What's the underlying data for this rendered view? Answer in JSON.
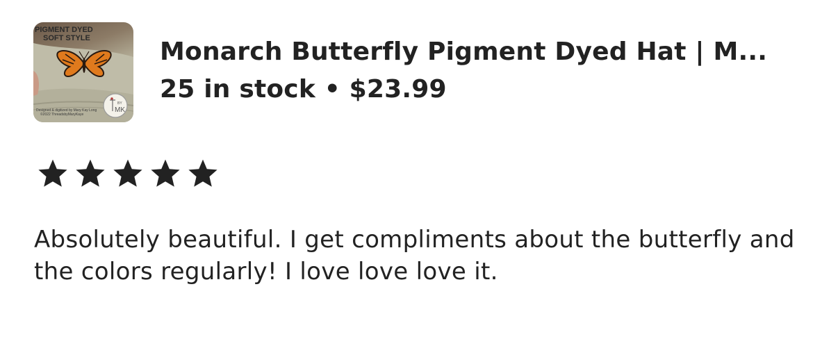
{
  "product": {
    "title": "Monarch Butterfly Pigment Dyed Hat | M...",
    "stock_text": "25 in stock",
    "separator": "•",
    "price": "$23.99",
    "thumbnail": {
      "top_text_line1": "PIGMENT DYED",
      "top_text_line2": "SOFT STYLE",
      "fine_print_line1": "Designed & digitized by Mary Kay Long",
      "fine_print_line2": "©2022 ThreadsbyMaryKaye",
      "badge_top": "BY",
      "badge_bottom": "MK"
    }
  },
  "review": {
    "rating": 5,
    "max_rating": 5,
    "text": "Absolutely beautiful. I get compliments about the butterfly and the colors regularly! I love love love it."
  },
  "colors": {
    "text": "#222222",
    "star": "#222222",
    "background": "#ffffff"
  }
}
